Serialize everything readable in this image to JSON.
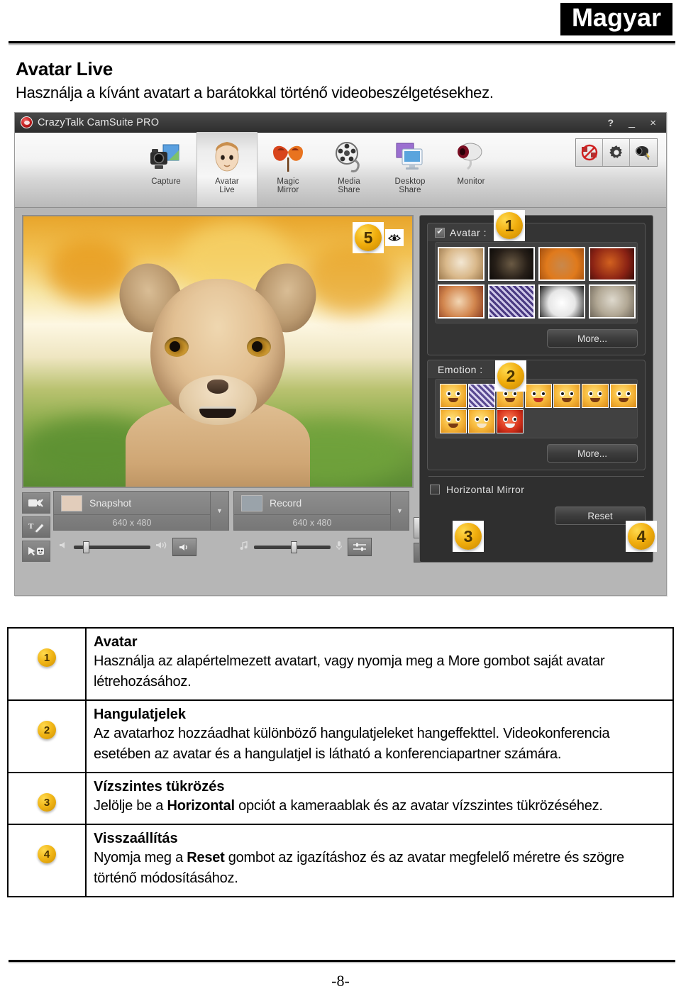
{
  "header": {
    "language_badge": "Magyar",
    "title": "Avatar Live",
    "subtitle": "Használja a kívánt avatart a barátokkal történő videobeszélgetésekhez."
  },
  "app_window": {
    "title": "CrazyTalk CamSuite PRO",
    "window_controls": {
      "help": "?",
      "minimize": "_",
      "close": "×"
    },
    "toolbar": {
      "items": [
        {
          "label_line1": "Capture",
          "label_line2": "",
          "icon": "camera-icon",
          "active": false
        },
        {
          "label_line1": "Avatar",
          "label_line2": "Live",
          "icon": "avatar-face-icon",
          "active": true
        },
        {
          "label_line1": "Magic",
          "label_line2": "Mirror",
          "icon": "mask-icon",
          "active": false
        },
        {
          "label_line1": "Media",
          "label_line2": "Share",
          "icon": "film-reel-icon",
          "active": false
        },
        {
          "label_line1": "Desktop",
          "label_line2": "Share",
          "icon": "monitor-share-icon",
          "active": false
        },
        {
          "label_line1": "Monitor",
          "label_line2": "",
          "icon": "webcam-icon",
          "active": false
        }
      ],
      "right_buttons": [
        {
          "icon": "no-webcam-icon"
        },
        {
          "icon": "gear-icon"
        },
        {
          "icon": "camera-settings-icon"
        }
      ]
    },
    "preview": {
      "callout_badge": "5",
      "eye_icon": "eye-icon",
      "subject": "lion-cub-photo"
    },
    "capture_bar": {
      "side_buttons": [
        {
          "icon": "video-cut-icon"
        },
        {
          "icon": "text-pen-icon"
        },
        {
          "icon": "emoticon-cursor-icon"
        }
      ],
      "snapshot": {
        "label": "Snapshot",
        "resolution": "640 x 480",
        "dropdown": "▼",
        "thumb": "face-thumb-icon"
      },
      "record": {
        "label": "Record",
        "resolution": "640 x 480",
        "dropdown": "▼",
        "thumb": "screen-thumb-icon"
      },
      "speaker_slider": {
        "left_icon": "speaker-low-icon",
        "right_icon": "speaker-high-icon",
        "button_icon": "speaker-icon",
        "knob_pct": 12
      },
      "mic_slider": {
        "left_icon": "music-note-icon",
        "right_icon": "mic-icon",
        "button_icon": "mixer-icon",
        "knob_pct": 48
      },
      "play_button_icon": "play-icon",
      "music_button_icon": "music-file-icon"
    },
    "right_panel": {
      "avatar_group": {
        "label": "Avatar :",
        "checked": true,
        "callout_badge": "1",
        "thumbnails": [
          {
            "name": "boy-avatar",
            "c1": "#f3e7d3",
            "c2": "#c79a63"
          },
          {
            "name": "dark-knight-avatar",
            "c1": "#1a1410",
            "c2": "#544535"
          },
          {
            "name": "bald-man-avatar",
            "c1": "#e07a1c",
            "c2": "#8e4f14"
          },
          {
            "name": "red-warrior-avatar",
            "c1": "#7a1d14",
            "c2": "#d2611f"
          },
          {
            "name": "doll-avatar",
            "c1": "#e8c49a",
            "c2": "#b5582e"
          },
          {
            "name": "purple-pattern-avatar",
            "c1": "#4a3a82",
            "c2": "#9f96c9"
          },
          {
            "name": "panda-avatar",
            "c1": "#f2f2f2",
            "c2": "#1a1a1a"
          },
          {
            "name": "stone-statue-avatar",
            "c1": "#d9d4c8",
            "c2": "#8a8172"
          }
        ],
        "more_button": "More..."
      },
      "emotion_group": {
        "label": "Emotion :",
        "callout_badge": "2",
        "emoticon_count": 10,
        "emoticons": [
          "angry-wink-emoticon",
          "selected-emoticon",
          "sleepy-emoticon",
          "kiss-emoticon",
          "whistle-emoticon",
          "surprised-emoticon",
          "crying-emoticon",
          "smile-emoticon",
          "grin-emoticon",
          "devil-emoticon"
        ],
        "more_button": "More..."
      },
      "horizontal_mirror": {
        "label": "Horizontal Mirror",
        "checked": false,
        "callout_badge": "3"
      },
      "reset_button": {
        "label": "Reset",
        "callout_badge": "4"
      }
    }
  },
  "descriptions": [
    {
      "num": "1",
      "title": "Avatar",
      "body_html": "Használja az alapértelmezett avatart, vagy nyomja meg a More gombot saját avatar létrehozásához."
    },
    {
      "num": "2",
      "title": "Hangulatjelek",
      "body_html": "Az avatarhoz hozzáadhat különböző hangulatjeleket hangeffekttel. Videokonferencia esetében az avatar és a hangulatjel is látható a konferenciapartner számára."
    },
    {
      "num": "3",
      "title": "Vízszintes tükrözés",
      "body_html": "Jelölje be a <b>Horizontal</b> opciót a kameraablak és az avatar vízszintes tükrözéséhez."
    },
    {
      "num": "4",
      "title": "Visszaállítás",
      "body_html": "Nyomja meg a <b>Reset</b> gombot az igazításhoz és az avatar megfelelő méretre és szögre történő módosításához."
    }
  ],
  "footer": {
    "page_number": "-8-"
  },
  "colors": {
    "badge_yellow": "#f0b516",
    "panel_dark": "#2f2f2f",
    "titlebar_dark": "#3b3b3b",
    "accent_black": "#000000"
  }
}
